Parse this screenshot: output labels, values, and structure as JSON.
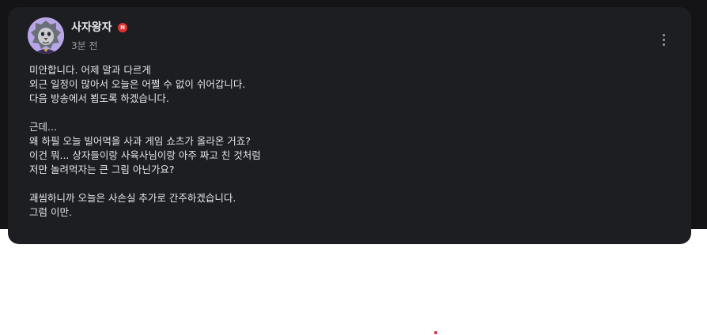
{
  "post": {
    "author": "사자왕자",
    "badge": "N",
    "timestamp": "3분 전",
    "more_icon": "more-vertical-icon",
    "paragraphs": [
      [
        "미안합니다. 어제 말과 다르게",
        "외근 일정이 많아서 오늘은 어쩔 수 없이 쉬어갑니다.",
        "다음 방송에서 뵙도록 하겠습니다."
      ],
      [
        "근데...",
        "왜 하필 오늘 빌어먹을 사과 게임 쇼츠가 올라온 거죠?",
        "이건 뭐... 상자들이랑 사육사님이랑 아주 짜고 친 것처럼",
        "저만 놀려먹자는 큰 그림 아닌가요?"
      ],
      [
        "괘씸하니까 오늘은 사손실 추가로 간주하겠습니다.",
        "그럼 이만."
      ]
    ]
  },
  "colors": {
    "background_dark": "#141416",
    "card": "#1d1e22",
    "text": "#e4e4ea",
    "muted": "#9a9ba1",
    "badge": "#e03030"
  }
}
